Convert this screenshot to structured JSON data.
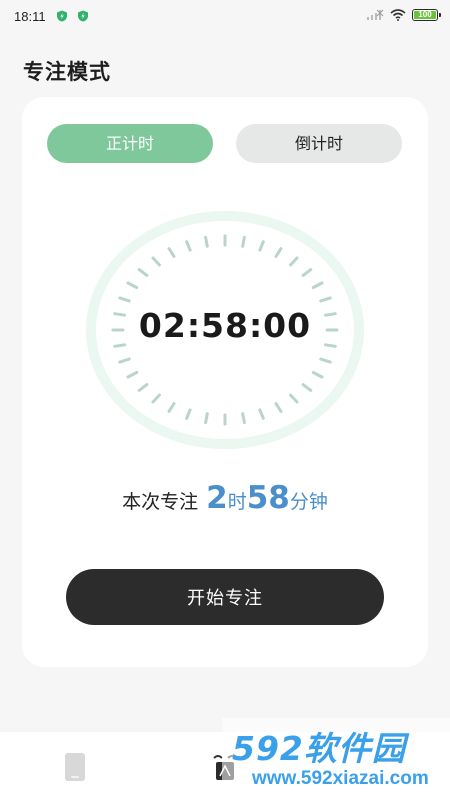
{
  "status_bar": {
    "time": "18:11",
    "battery_level": "100"
  },
  "header": {
    "title": "专注模式"
  },
  "tabs": [
    {
      "label": "正计时",
      "active": true
    },
    {
      "label": "倒计时",
      "active": false
    }
  ],
  "timer": {
    "display": "02:58:00"
  },
  "focus_summary": {
    "label": "本次专注",
    "hours": "2",
    "hours_unit": "时",
    "minutes": "58",
    "minutes_unit": "分钟"
  },
  "start_button": {
    "label": "开始专注"
  },
  "bottom_nav": {
    "items": [
      "phone-icon",
      "focus-icon"
    ]
  },
  "watermark": {
    "logo": "592软件园",
    "url": "www.592xiazai.com"
  },
  "colors": {
    "accent_green": "#7fc89b",
    "accent_blue": "#4a8fcb",
    "button_dark": "#2b2c2b"
  }
}
